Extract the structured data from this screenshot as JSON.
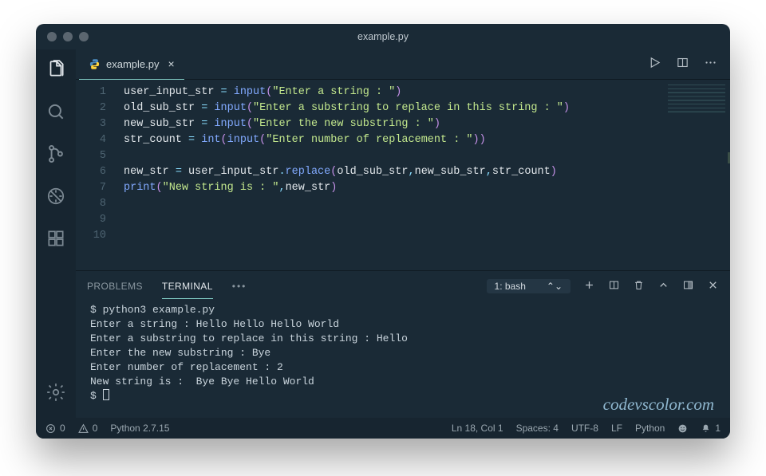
{
  "window_title": "example.py",
  "tab": {
    "name": "example.py"
  },
  "code": {
    "lines": [
      [
        {
          "t": "user_input_str ",
          "c": "c-var"
        },
        {
          "t": "= ",
          "c": "c-op"
        },
        {
          "t": "input",
          "c": "c-func"
        },
        {
          "t": "(",
          "c": "c-paren"
        },
        {
          "t": "\"Enter a string : \"",
          "c": "c-str"
        },
        {
          "t": ")",
          "c": "c-paren"
        }
      ],
      [
        {
          "t": "old_sub_str ",
          "c": "c-var"
        },
        {
          "t": "= ",
          "c": "c-op"
        },
        {
          "t": "input",
          "c": "c-func"
        },
        {
          "t": "(",
          "c": "c-paren"
        },
        {
          "t": "\"Enter a substring to replace in this string : \"",
          "c": "c-str"
        },
        {
          "t": ")",
          "c": "c-paren"
        }
      ],
      [
        {
          "t": "new_sub_str ",
          "c": "c-var"
        },
        {
          "t": "= ",
          "c": "c-op"
        },
        {
          "t": "input",
          "c": "c-func"
        },
        {
          "t": "(",
          "c": "c-paren"
        },
        {
          "t": "\"Enter the new substring : \"",
          "c": "c-str"
        },
        {
          "t": ")",
          "c": "c-paren"
        }
      ],
      [
        {
          "t": "str_count ",
          "c": "c-var"
        },
        {
          "t": "= ",
          "c": "c-op"
        },
        {
          "t": "int",
          "c": "c-func"
        },
        {
          "t": "(",
          "c": "c-paren"
        },
        {
          "t": "input",
          "c": "c-func"
        },
        {
          "t": "(",
          "c": "c-paren"
        },
        {
          "t": "\"Enter number of replacement : \"",
          "c": "c-str"
        },
        {
          "t": ")",
          "c": "c-paren"
        },
        {
          "t": ")",
          "c": "c-paren"
        }
      ],
      [],
      [
        {
          "t": "new_str ",
          "c": "c-var"
        },
        {
          "t": "= ",
          "c": "c-op"
        },
        {
          "t": "user_input_str",
          "c": "c-var"
        },
        {
          "t": ".",
          "c": "c-op"
        },
        {
          "t": "replace",
          "c": "c-func"
        },
        {
          "t": "(",
          "c": "c-paren"
        },
        {
          "t": "old_sub_str",
          "c": "c-var"
        },
        {
          "t": ",",
          "c": "c-op"
        },
        {
          "t": "new_sub_str",
          "c": "c-var"
        },
        {
          "t": ",",
          "c": "c-op"
        },
        {
          "t": "str_count",
          "c": "c-var"
        },
        {
          "t": ")",
          "c": "c-paren"
        }
      ],
      [
        {
          "t": "print",
          "c": "c-func"
        },
        {
          "t": "(",
          "c": "c-paren"
        },
        {
          "t": "\"New string is : \"",
          "c": "c-str"
        },
        {
          "t": ",",
          "c": "c-op"
        },
        {
          "t": "new_str",
          "c": "c-var"
        },
        {
          "t": ")",
          "c": "c-paren"
        }
      ],
      [],
      [],
      []
    ]
  },
  "panel": {
    "tabs": {
      "problems": "PROBLEMS",
      "terminal": "TERMINAL"
    },
    "ellipsis": "•••",
    "terminal_select": "1: bash",
    "output": [
      "$ python3 example.py",
      "Enter a string : Hello Hello Hello World",
      "Enter a substring to replace in this string : Hello",
      "Enter the new substring : Bye",
      "Enter number of replacement : 2",
      "New string is :  Bye Bye Hello World"
    ],
    "prompt": "$ "
  },
  "watermark": "codevscolor.com",
  "statusbar": {
    "errors": "0",
    "warnings": "0",
    "python_version": "Python 2.7.15",
    "cursor": "Ln 18, Col 1",
    "spaces": "Spaces: 4",
    "encoding": "UTF-8",
    "eol": "LF",
    "lang": "Python",
    "bell": "1"
  }
}
